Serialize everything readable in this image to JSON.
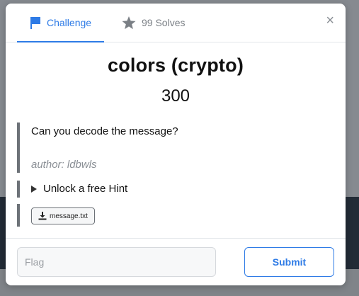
{
  "tabs": {
    "challenge_label": "Challenge",
    "solves_label": "99 Solves"
  },
  "close_glyph": "×",
  "challenge": {
    "title": "colors (crypto)",
    "points": "300",
    "description": "Can you decode the message?",
    "author": "author: ldbwls"
  },
  "hint": {
    "label": "Unlock a free Hint"
  },
  "file": {
    "name": "message.txt"
  },
  "flag": {
    "placeholder": "Flag",
    "value": ""
  },
  "submit_label": "Submit",
  "colors": {
    "accent": "#2e7be6",
    "bar": "#6d7278"
  },
  "icons": {
    "challenge_tab": "flag-icon",
    "solves_tab": "star-icon",
    "file": "download-icon"
  }
}
